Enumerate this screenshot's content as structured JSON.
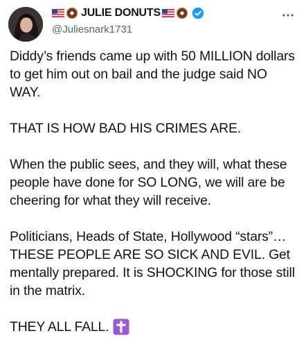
{
  "author": {
    "display_name": "JULIE DONUTS",
    "handle": "@Juliesnark1731",
    "name_emojis": [
      "us-flag-icon",
      "donut-icon"
    ],
    "verified": true
  },
  "tweet": {
    "paragraphs": [
      "Diddy’s friends came up with 50 MILLION dollars to get him out on bail and the judge said NO WAY.",
      "THAT IS HOW BAD HIS CRIMES ARE.",
      "When the public sees, and they will, what these people have done for SO LONG, we will are be cheering for what they will receive.",
      "Politicians, Heads of State, Hollywood “stars”…THESE PEOPLE ARE SO SICK AND EVIL. Get mentally prepared. It is SHOCKING for those still in the matrix."
    ],
    "final_line": "THEY ALL FALL.",
    "final_emoji": "cross-icon"
  },
  "colors": {
    "text": "#0f1419",
    "secondary": "#536471",
    "verified": "#1d9bf0",
    "cross_bg": "#9b59d0"
  }
}
